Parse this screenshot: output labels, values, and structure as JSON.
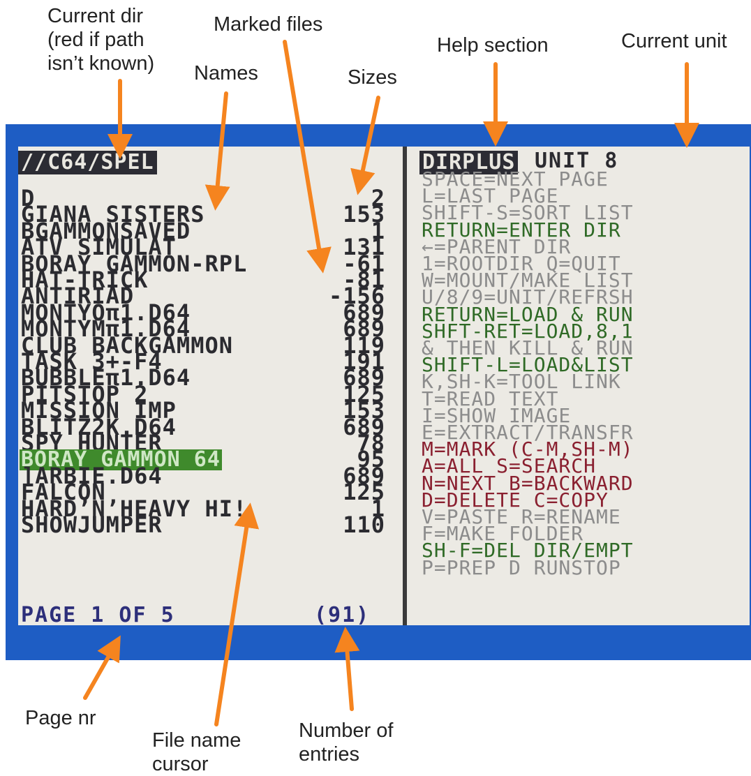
{
  "annotations": {
    "current_dir_1": "Current dir",
    "current_dir_2": "(red if path",
    "current_dir_3": "isn’t known)",
    "names": "Names",
    "marked_files": "Marked files",
    "sizes": "Sizes",
    "help_section": "Help section",
    "current_unit": "Current unit",
    "page_nr": "Page nr",
    "cursor_1": "File name",
    "cursor_2": "cursor",
    "entries_1": "Number of",
    "entries_2": "entries"
  },
  "screen": {
    "path": "//C64/SPEL",
    "app_name": "DIRPLUS",
    "unit": "UNIT 8",
    "files": [
      {
        "name": "D",
        "size": "2"
      },
      {
        "name": "GIANA SISTERS",
        "size": "153"
      },
      {
        "name": "BGAMMONSAVED",
        "size": "1"
      },
      {
        "name": "ATV SIMULAT",
        "size": "131"
      },
      {
        "name": "BORAY GAMMON-RPL",
        "size": "-61"
      },
      {
        "name": "HAT-TRICK",
        "size": "-81"
      },
      {
        "name": "ANTIRIAD",
        "size": "-156"
      },
      {
        "name": "MONTYOπ1.D64",
        "size": "689"
      },
      {
        "name": "MONTYMπ1.D64",
        "size": "689"
      },
      {
        "name": "CLUB BACKGAMMON",
        "size": "119"
      },
      {
        "name": "TASK 3+-F4",
        "size": "191"
      },
      {
        "name": "BUBBLEπ1.D64",
        "size": "689"
      },
      {
        "name": "PITSTOP 2",
        "size": "125"
      },
      {
        "name": "MISSION IMP",
        "size": "153"
      },
      {
        "name": "BLITZ2K.D64",
        "size": "689"
      },
      {
        "name": "SPY HUNTER",
        "size": "78"
      },
      {
        "name": "BORAY GAMMON 64",
        "size": "95"
      },
      {
        "name": "]ARBIE.D64",
        "size": "689"
      },
      {
        "name": "FALCON",
        "size": "125"
      },
      {
        "name": "HARD’N’HEAVY HI!",
        "size": "1"
      },
      {
        "name": "SHOWJUMPER",
        "size": "110"
      }
    ],
    "page_text": "PAGE 1 OF 5",
    "entry_count": "(91)",
    "help_lines": [
      "SPACE=NEXT PAGE",
      "L=LAST PAGE",
      "SHIFT-S=SORT LIST",
      "RETURN=ENTER DIR",
      "←=PARENT DIR",
      "1=ROOTDIR Q=QUIT",
      "W=MOUNT/MAKE LIST",
      "U/8/9=UNIT/REFRSH",
      "RETURN=LOAD & RUN",
      "SHFT-RET=LOAD,8,1",
      "& THEN KILL & RUN",
      "SHIFT-L=LOAD&LIST",
      "K,SH-K=TOOL LINK",
      "T=READ TEXT",
      "I=SHOW IMAGE",
      "E=EXTRACT/TRANSFR",
      "M=MARK (C-M,SH-M)",
      "A=ALL S=SEARCH",
      "N=NEXT B=BACKWARD",
      "D=DELETE C=COPY",
      "V=PASTE R=RENAME",
      "F=MAKE FOLDER",
      "SH-F=DEL DIR/EMPT",
      "P=PREP D RUNSTOP"
    ]
  },
  "colors": {
    "screen_border": "#1e5dc4",
    "screen_background": "#eceae4",
    "arrow": "#f5841f",
    "cursor": "#3f8a2c",
    "key_green": "#2f6a26",
    "key_red": "#8a2030",
    "footer_blue": "#2d2f7a"
  }
}
